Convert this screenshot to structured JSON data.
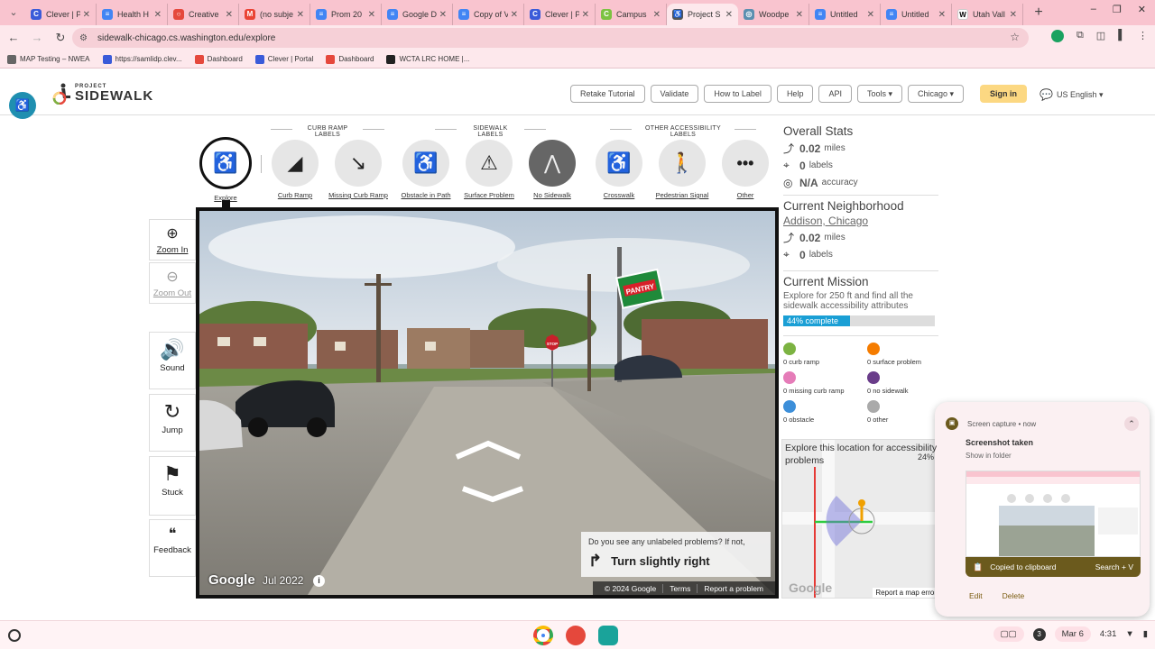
{
  "browser": {
    "tabs": [
      {
        "label": "Clever | P",
        "color": "#3a5bd9",
        "glyph": "C"
      },
      {
        "label": "Health H",
        "color": "#4285f4",
        "glyph": "≡"
      },
      {
        "label": "Creative",
        "color": "#e5483c",
        "glyph": "○"
      },
      {
        "label": "(no subje",
        "color": "#ea4335",
        "glyph": "M"
      },
      {
        "label": "Prom 20",
        "color": "#4285f4",
        "glyph": "≡"
      },
      {
        "label": "Google D",
        "color": "#4285f4",
        "glyph": "≡"
      },
      {
        "label": "Copy of V",
        "color": "#4285f4",
        "glyph": "≡"
      },
      {
        "label": "Clever | P",
        "color": "#3a5bd9",
        "glyph": "C"
      },
      {
        "label": "Campus",
        "color": "#7cc242",
        "glyph": "C"
      },
      {
        "label": "Project S",
        "color": "#555555",
        "glyph": "♿",
        "active": true
      },
      {
        "label": "Woodpe",
        "color": "#5a8fb0",
        "glyph": "◎"
      },
      {
        "label": "Untitled",
        "color": "#4285f4",
        "glyph": "≡"
      },
      {
        "label": "Untitled",
        "color": "#4285f4",
        "glyph": "≡"
      },
      {
        "label": "Utah Vall",
        "color": "#ffffff",
        "glyph": "W"
      }
    ],
    "url": "sidewalk-chicago.cs.washington.edu/explore",
    "bookmarks": [
      {
        "label": "MAP Testing – NWEA",
        "color": "#666666"
      },
      {
        "label": "https://samlidp.clev...",
        "color": "#3a5bd9"
      },
      {
        "label": "Dashboard",
        "color": "#e5483c"
      },
      {
        "label": "Clever | Portal",
        "color": "#3a5bd9"
      },
      {
        "label": "Dashboard",
        "color": "#e5483c"
      },
      {
        "label": "WCTA LRC HOME |...",
        "color": "#222222"
      }
    ]
  },
  "site": {
    "logo_small": "PROJECT",
    "logo_big": "SIDEWALK",
    "nav": [
      "Retake Tutorial",
      "Validate",
      "How to Label",
      "Help",
      "API",
      "Tools ▾",
      "Chicago ▾"
    ],
    "signin": "Sign in",
    "language": "US English ▾"
  },
  "label_groups": {
    "curb": "CURB RAMP LABELS",
    "sidewalk": "SIDEWALK LABELS",
    "other": "OTHER ACCESSIBILITY LABELS"
  },
  "label_buttons": {
    "explore": "Explore",
    "curb_ramp": "Curb Ramp",
    "missing_curb_ramp": "Missing Curb Ramp",
    "obstacle": "Obstacle in Path",
    "surface": "Surface Problem",
    "no_sidewalk": "No Sidewalk",
    "crosswalk": "Crosswalk",
    "ped_signal": "Pedestrian Signal",
    "other": "Other"
  },
  "tools": {
    "zoom_in": "Zoom In",
    "zoom_out": "Zoom Out",
    "sound": "Sound",
    "jump": "Jump",
    "stuck": "Stuck",
    "feedback": "Feedback"
  },
  "pano": {
    "prompt_question": "Do you see any unlabeled problems? If not,",
    "prompt_action": "Turn slightly right",
    "google": "Google",
    "date": "Jul 2022",
    "footer": [
      "© 2024 Google",
      "Terms",
      "Report a problem"
    ],
    "stop_sign": "STOP",
    "store_sign": "PANTRY"
  },
  "overall": {
    "title": "Overall Stats",
    "miles_value": "0.02",
    "miles_unit": "miles",
    "labels_value": "0",
    "labels_unit": "labels",
    "accuracy_value": "N/A",
    "accuracy_unit": "accuracy"
  },
  "neighborhood": {
    "title": "Current Neighborhood",
    "name": "Addison, Chicago",
    "miles_value": "0.02",
    "miles_unit": "miles",
    "labels_value": "0",
    "labels_unit": "labels"
  },
  "mission": {
    "title": "Current Mission",
    "text": "Explore for 250 ft and find all the sidewalk accessibility attributes",
    "progress_percent": 44,
    "progress_text": "44% complete"
  },
  "counts": [
    {
      "label": "0 curb ramp",
      "color": "#7cb342"
    },
    {
      "label": "0 surface problem",
      "color": "#f57c00"
    },
    {
      "label": "0 missing curb ramp",
      "color": "#e57cb8"
    },
    {
      "label": "0 no sidewalk",
      "color": "#6a3d8a"
    },
    {
      "label": "0 obstacle",
      "color": "#3d8fd9"
    },
    {
      "label": "0 other",
      "color": "#aaaaaa"
    }
  ],
  "minimap": {
    "text": "Explore this location for accessibility problems",
    "percent": "24%",
    "google": "Google",
    "report": "Report a map error"
  },
  "notification": {
    "app": "Screen capture",
    "time": "now",
    "title": "Screenshot taken",
    "sub": "Show in folder",
    "copied": "Copied to clipboard",
    "shortcut": "Search + V",
    "edit": "Edit",
    "delete": "Delete"
  },
  "shelf": {
    "badge": "3",
    "date": "Mar 6",
    "time": "4:31"
  }
}
